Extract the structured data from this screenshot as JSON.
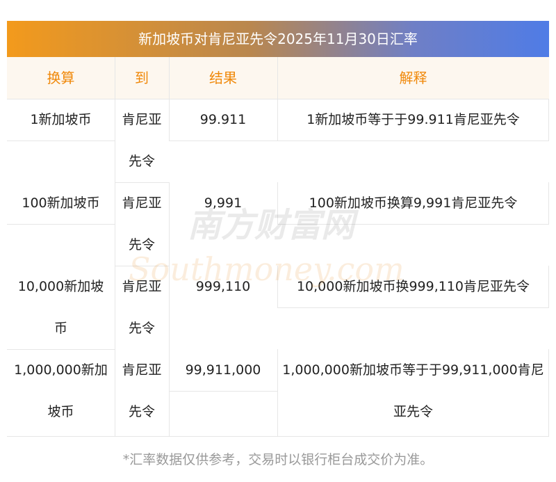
{
  "title": "新加坡币对肯尼亚先令2025年11月30日汇率",
  "headers": {
    "convert": "换算",
    "to": "到",
    "result": "结果",
    "explain": "解释"
  },
  "rows": [
    {
      "from_l1": "1新加坡币",
      "from_l2": "",
      "to_l1": "肯尼亚",
      "to_l2": "先令",
      "result": "99.911",
      "explain_l1": "1新加坡币等于于99.911肯尼亚先令",
      "explain_l2": ""
    },
    {
      "from_l1": "100新加坡币",
      "from_l2": "",
      "to_l1": "肯尼亚",
      "to_l2": "先令",
      "result": "9,991",
      "explain_l1": "100新加坡币换算9,991肯尼亚先令",
      "explain_l2": ""
    },
    {
      "from_l1": "10,000新加坡",
      "from_l2": "币",
      "to_l1": "肯尼亚",
      "to_l2": "先令",
      "result": "999,110",
      "explain_l1": "10,000新加坡币换999,110肯尼亚先令",
      "explain_l2": ""
    },
    {
      "from_l1": "1,000,000新加",
      "from_l2": "坡币",
      "to_l1": "肯尼亚",
      "to_l2": "先令",
      "result": "99,911,000",
      "explain_l1": "1,000,000新加坡币等于于99,911,000肯尼",
      "explain_l2": "亚先令"
    }
  ],
  "watermark": {
    "cn": "南方财富网",
    "en": "Southmoney.com"
  },
  "footer": "*汇率数据仅供参考，交易时以银行柜台成交价为准。",
  "colors": {
    "accent": "#f0890b",
    "gradient_start": "#f39a1c",
    "gradient_end": "#4f7ce6"
  }
}
